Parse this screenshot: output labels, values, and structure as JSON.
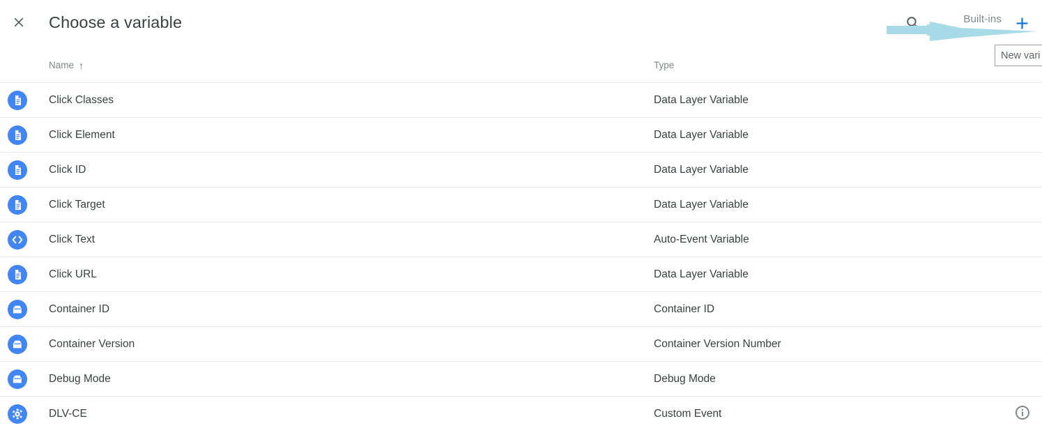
{
  "header": {
    "title": "Choose a variable",
    "close_label": "close-icon",
    "search_label": "search-icon",
    "builtins_label": "Built-ins",
    "add_label": "add-icon"
  },
  "tooltip": {
    "text": "New vari"
  },
  "columns": {
    "name": "Name",
    "name_sort": "↑",
    "type": "Type"
  },
  "colors": {
    "accent_blue": "#4285f4",
    "add_blue": "#1a73e8",
    "annotation_arrow": "#a8dbe8",
    "icon_gray": "#5f6368",
    "text_primary": "#3c4043",
    "text_secondary": "#80868b",
    "divider": "#e8eaed"
  },
  "rows": [
    {
      "icon": "data-layer-variable-icon",
      "name": "Click Classes",
      "type": "Data Layer Variable"
    },
    {
      "icon": "data-layer-variable-icon",
      "name": "Click Element",
      "type": "Data Layer Variable"
    },
    {
      "icon": "data-layer-variable-icon",
      "name": "Click ID",
      "type": "Data Layer Variable"
    },
    {
      "icon": "data-layer-variable-icon",
      "name": "Click Target",
      "type": "Data Layer Variable"
    },
    {
      "icon": "auto-event-variable-icon",
      "name": "Click Text",
      "type": "Auto-Event Variable"
    },
    {
      "icon": "data-layer-variable-icon",
      "name": "Click URL",
      "type": "Data Layer Variable"
    },
    {
      "icon": "container-icon",
      "name": "Container ID",
      "type": "Container ID"
    },
    {
      "icon": "container-icon",
      "name": "Container Version",
      "type": "Container Version Number"
    },
    {
      "icon": "container-icon",
      "name": "Debug Mode",
      "type": "Debug Mode"
    },
    {
      "icon": "custom-event-icon",
      "name": "DLV-CE",
      "type": "Custom Event"
    }
  ],
  "footer": {
    "info_label": "info-icon"
  }
}
